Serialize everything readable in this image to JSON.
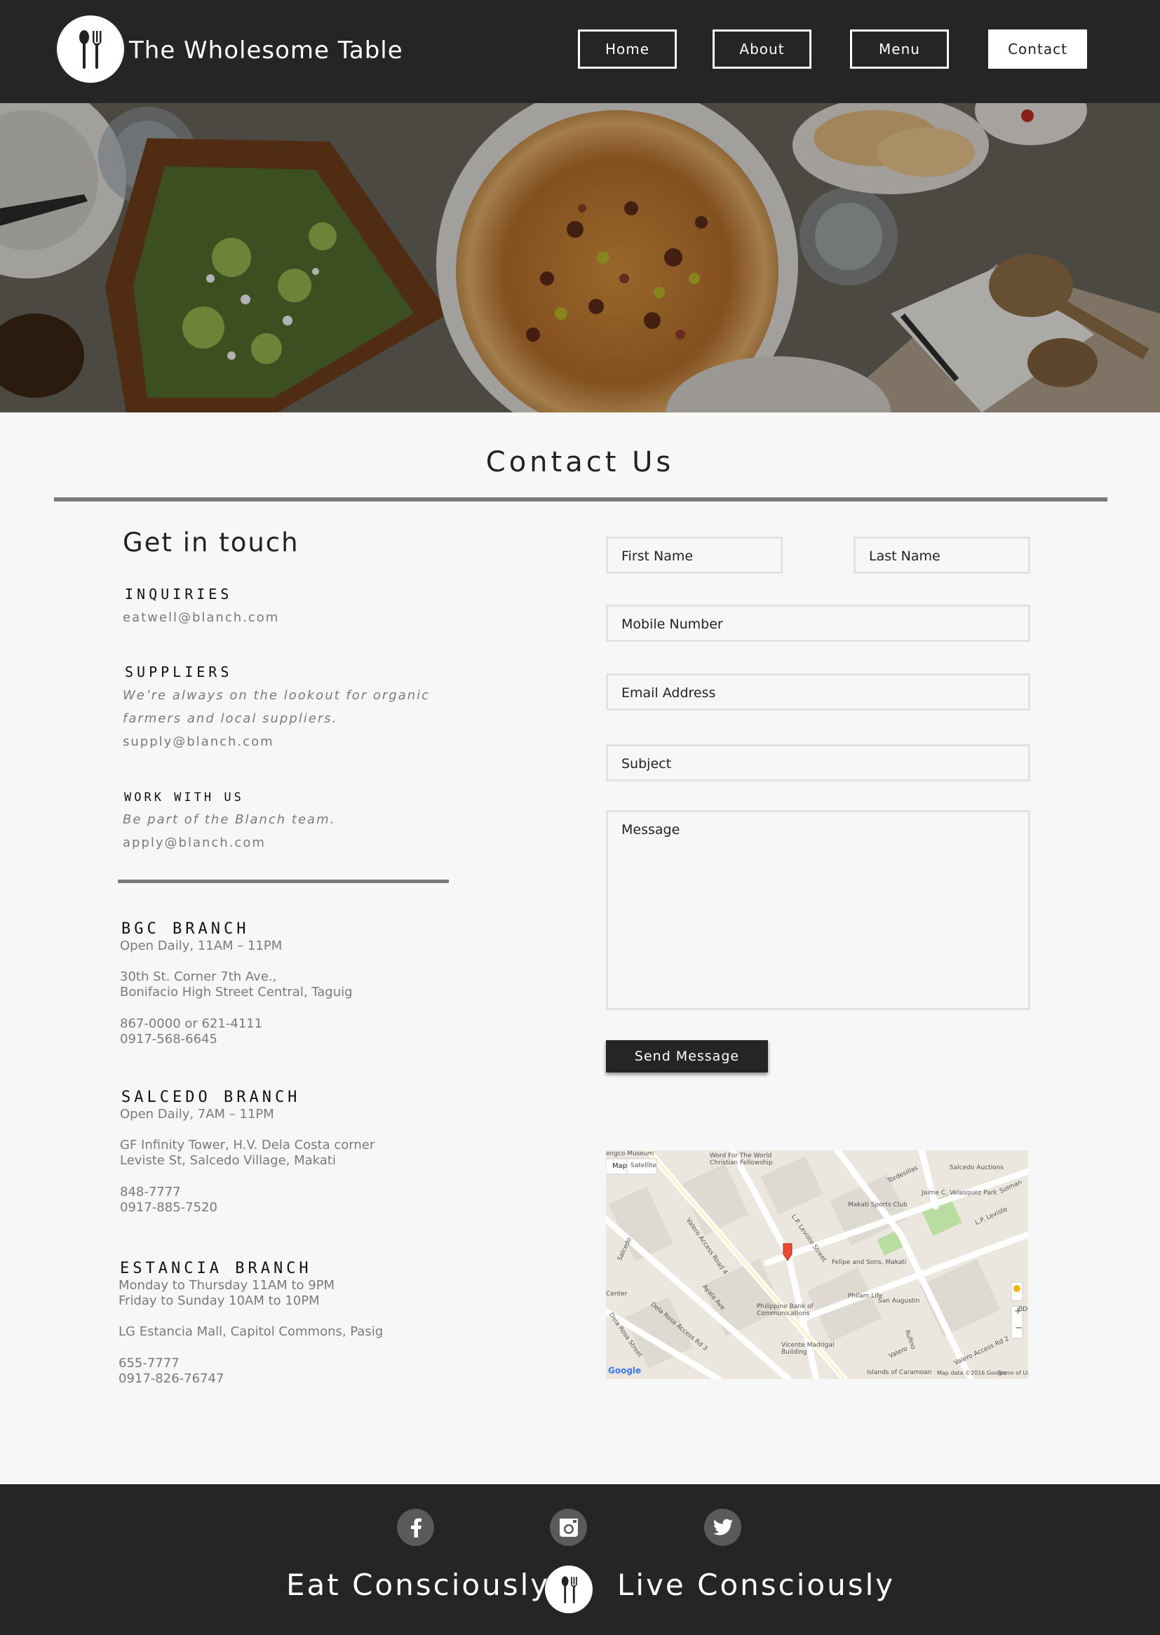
{
  "brand": {
    "name": "The Wholesome Table",
    "logo_icon": "fork-spoon-icon"
  },
  "nav": {
    "home": "Home",
    "about": "About",
    "menu": "Menu",
    "contact": "Contact"
  },
  "contact_title": "Contact Us",
  "left": {
    "heading": "Get in touch",
    "inquiries": {
      "label": "INQUIRIES",
      "email": "eatwell@blanch.com"
    },
    "suppliers": {
      "label": "SUPPLIERS",
      "line1": "We’re always on the lookout for organic",
      "line2": "farmers and local suppliers.",
      "email": "supply@blanch.com"
    },
    "work": {
      "label": "WORK WITH US",
      "line1": "Be part of the Blanch team.",
      "email": "apply@blanch.com"
    }
  },
  "branches": [
    {
      "title": "BGC BRANCH",
      "lines": [
        "Open Daily, 11AM – 11PM",
        "30th St. Corner 7th Ave.,",
        "Bonifacio High Street Central, Taguig",
        "867-0000 or 621-4111",
        "0917-568-6645"
      ]
    },
    {
      "title": "SALCEDO BRANCH",
      "lines": [
        "Open Daily, 7AM – 11PM",
        "GF Infinity Tower, H.V. Dela Costa corner",
        "Leviste St, Salcedo Village, Makati",
        "848-7777",
        "0917-885-7520"
      ]
    },
    {
      "title": "ESTANCIA BRANCH",
      "lines": [
        "Monday to Thursday 11AM to 9PM",
        "Friday to Sunday 10AM to 10PM",
        "LG Estancia Mall, Capitol Commons, Pasig",
        "655-7777",
        "0917-826-76747"
      ]
    }
  ],
  "form": {
    "first_name": "First Name",
    "last_name": "Last Name",
    "mobile": "Mobile Number",
    "email": "Email Address",
    "subject": "Subject",
    "message": "Message",
    "send": "Send Message"
  },
  "map": {
    "tab_map": "Map",
    "tab_satellite": "Satellite",
    "labels": [
      "Word For The World",
      "Christian Fellowship",
      "Salcedo Auctions",
      "Jaime C. Velasquez Park",
      "Makati Sports Club",
      "Felipe and Sons, Makati",
      "Philam Life",
      "Philippine Bank of",
      "Communications",
      "Vicente Madrigal",
      "Building",
      "San Augustin",
      "Valero Access Road 4",
      "Ayala Ave",
      "L.P. Leviste Street",
      "Tordesillas",
      "Salcedo",
      "Dela Rosa Street",
      "Dela Rosa Access Rd 3",
      "Valero",
      "L.P. Leviste",
      "Solman",
      "Valero Access Rd 2",
      "Rufino",
      "Islands of Caramoan",
      "engco Museum",
      "BDO",
      "Center"
    ],
    "attribution": "Map data ©2016 Google",
    "terms": "Terms of Use",
    "google": "Google",
    "zoom_in": "+",
    "zoom_out": "−"
  },
  "footer": {
    "left_tagline": "Eat Consciously",
    "right_tagline": "Live Consciously",
    "social_icons": [
      "facebook-icon",
      "instagram-icon",
      "twitter-icon"
    ]
  },
  "colors": {
    "dark": "#252525",
    "page_bg": "#f7f7f7",
    "rule": "#7a7a7a",
    "muted_text": "#7a7a7a"
  }
}
